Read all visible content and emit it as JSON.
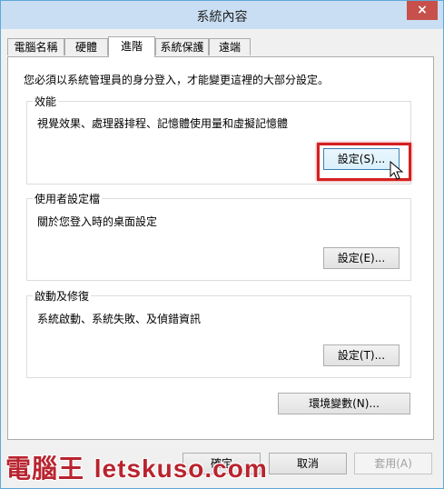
{
  "window": {
    "title": "系統內容",
    "close_glyph": "×"
  },
  "tabs": [
    {
      "label": "電腦名稱"
    },
    {
      "label": "硬體"
    },
    {
      "label": "進階",
      "active": true
    },
    {
      "label": "系統保護"
    },
    {
      "label": "遠端"
    }
  ],
  "notice": "您必須以系統管理員的身分登入，才能變更這裡的大部分設定。",
  "performance": {
    "title": "效能",
    "description": "視覺效果、處理器排程、記憶體使用量和虛擬記憶體",
    "button": "設定(S)..."
  },
  "user_profiles": {
    "title": "使用者設定檔",
    "description": "關於您登入時的桌面設定",
    "button": "設定(E)..."
  },
  "startup_recovery": {
    "title": "啟動及修復",
    "description": "系統啟動、系統失敗、及偵錯資訊",
    "button": "設定(T)..."
  },
  "env_button": "環境變數(N)...",
  "footer": {
    "ok": "確定",
    "cancel": "取消",
    "apply": "套用(A)"
  },
  "watermark": {
    "cjk": "電腦王",
    "latin": "letskuso.com"
  },
  "colors": {
    "highlight": "#d42020",
    "titlebar": "#c9def3",
    "close_button": "#c7504a"
  }
}
